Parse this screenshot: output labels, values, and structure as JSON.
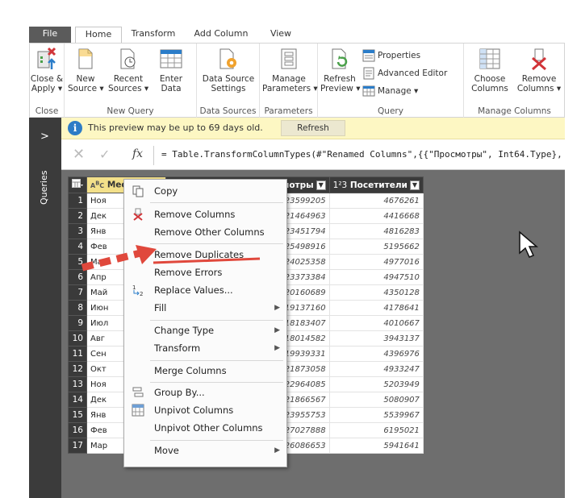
{
  "ribbon": {
    "tabs": [
      "File",
      "Home",
      "Transform",
      "Add Column",
      "View"
    ],
    "groups": {
      "close": {
        "label": "Close",
        "button1": "Close &",
        "button2": "Apply ▾"
      },
      "new_query": {
        "label": "New Query",
        "new_source_1": "New",
        "new_source_2": "Source ▾",
        "recent_1": "Recent",
        "recent_2": "Sources ▾",
        "enter_1": "Enter",
        "enter_2": "Data"
      },
      "data_sources": {
        "label": "Data Sources",
        "settings_1": "Data Source",
        "settings_2": "Settings"
      },
      "parameters": {
        "label": "Parameters",
        "manage_1": "Manage",
        "manage_2": "Parameters ▾"
      },
      "query": {
        "label": "Query",
        "refresh_1": "Refresh",
        "refresh_2": "Preview ▾",
        "properties": "Properties",
        "advanced_editor": "Advanced Editor",
        "manage": "Manage ▾"
      },
      "manage_columns": {
        "label": "Manage Columns",
        "choose_1": "Choose",
        "choose_2": "Columns",
        "remove_1": "Remove",
        "remove_2": "Columns ▾"
      }
    }
  },
  "rail": {
    "label": "Queries",
    "chevron": ">"
  },
  "infobar": {
    "message": "This preview may be up to 69 days old.",
    "refresh": "Refresh",
    "icon": "i"
  },
  "formula": {
    "fx": "fx",
    "text": "= Table.TransformColumnTypes(#\"Renamed Columns\",{{\"Просмотры\", Int64.Type},"
  },
  "grid": {
    "col1_type": "A B C",
    "col1": "Мес",
    "col2": "Просмотры",
    "col3_type": "1²3",
    "col3": "Посетители",
    "rows": [
      {
        "n": "1",
        "m": "Ноя",
        "v": "23599205",
        "p": "4676261"
      },
      {
        "n": "2",
        "m": "Дек",
        "v": "21464963",
        "p": "4416668"
      },
      {
        "n": "3",
        "m": "Янв",
        "v": "23451794",
        "p": "4816283"
      },
      {
        "n": "4",
        "m": "Фев",
        "v": "25498916",
        "p": "5195662"
      },
      {
        "n": "5",
        "m": "Мар",
        "v": "24025358",
        "p": "4977016"
      },
      {
        "n": "6",
        "m": "Апр",
        "v": "23373384",
        "p": "4947510"
      },
      {
        "n": "7",
        "m": "Май",
        "v": "20160689",
        "p": "4350128"
      },
      {
        "n": "8",
        "m": "Июн",
        "v": "19137160",
        "p": "4178641"
      },
      {
        "n": "9",
        "m": "Июл",
        "v": "18183407",
        "p": "4010667"
      },
      {
        "n": "10",
        "m": "Авг",
        "v": "18014582",
        "p": "3943137"
      },
      {
        "n": "11",
        "m": "Сен",
        "v": "19939331",
        "p": "4396976"
      },
      {
        "n": "12",
        "m": "Окт",
        "v": "21873058",
        "p": "4933247"
      },
      {
        "n": "13",
        "m": "Ноя",
        "v": "22964085",
        "p": "5203949"
      },
      {
        "n": "14",
        "m": "Дек",
        "v": "21866567",
        "p": "5080907"
      },
      {
        "n": "15",
        "m": "Янв",
        "v": "23955753",
        "p": "5539967"
      },
      {
        "n": "16",
        "m": "Фев",
        "v": "27027888",
        "p": "6195021"
      },
      {
        "n": "17",
        "m": "Мар",
        "v": "26086653",
        "p": "5941641",
        "y": "15"
      }
    ]
  },
  "menu": {
    "copy": "Copy",
    "remove_columns": "Remove Columns",
    "remove_other_columns": "Remove Other Columns",
    "remove_duplicates": "Remove Duplicates",
    "remove_errors": "Remove Errors",
    "replace_values": "Replace Values...",
    "fill": "Fill",
    "change_type": "Change Type",
    "transform": "Transform",
    "merge_columns": "Merge Columns",
    "group_by": "Group By...",
    "unpivot_columns": "Unpivot Columns",
    "unpivot_other_columns": "Unpivot Other Columns",
    "move": "Move"
  }
}
